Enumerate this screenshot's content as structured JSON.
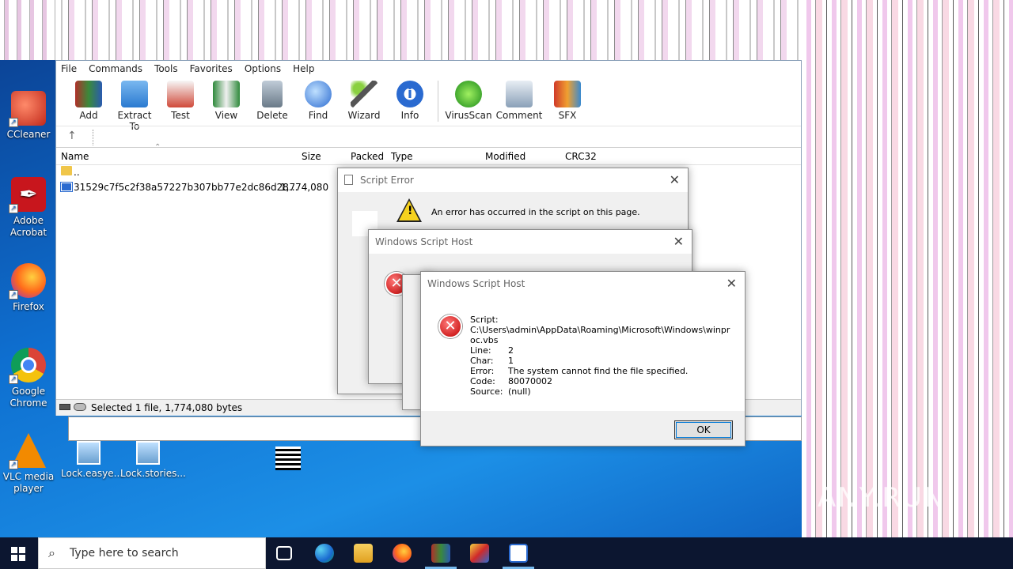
{
  "desktop": {
    "icons": [
      {
        "label": "CCleaner",
        "icon": "ccleaner-icon",
        "color": "#e8402d"
      },
      {
        "label": "Adobe Acrobat",
        "icon": "acrobat-icon",
        "color": "#d31f1f"
      },
      {
        "label": "Firefox",
        "icon": "firefox-icon",
        "color": "#ff7a1a"
      },
      {
        "label": "Google Chrome",
        "icon": "chrome-icon",
        "color": "#2e7de0"
      },
      {
        "label": "VLC media player",
        "icon": "vlc-icon",
        "color": "#f28a00"
      }
    ],
    "bottom_icons": [
      {
        "label": "Lock.easye...",
        "icon": "image-file-icon"
      },
      {
        "label": "Lock.stories...",
        "icon": "image-file-icon"
      }
    ],
    "watermark": "ANY.RUN"
  },
  "winrar": {
    "menu": [
      "File",
      "Commands",
      "Tools",
      "Favorites",
      "Options",
      "Help"
    ],
    "toolbar": [
      {
        "label": "Add",
        "icon": "add-archive-icon",
        "color": "#b0302a"
      },
      {
        "label": "Extract To",
        "icon": "extract-folder-icon",
        "color": "#3c8fe0"
      },
      {
        "label": "Test",
        "icon": "test-clipboard-icon",
        "color": "#c44a3a"
      },
      {
        "label": "View",
        "icon": "view-book-icon",
        "color": "#2f8a3c"
      },
      {
        "label": "Delete",
        "icon": "delete-bin-icon",
        "color": "#8a9aa8"
      },
      {
        "label": "Find",
        "icon": "find-magnifier-icon",
        "color": "#3a6fd0"
      },
      {
        "label": "Wizard",
        "icon": "wizard-wand-icon",
        "color": "#7a9a40"
      },
      {
        "label": "Info",
        "icon": "info-icon",
        "color": "#2a6fd0"
      },
      {
        "label": "VirusScan",
        "icon": "virusscan-icon",
        "color": "#2c9a2c"
      },
      {
        "label": "Comment",
        "icon": "comment-icon",
        "color": "#6a8aa8"
      },
      {
        "label": "SFX",
        "icon": "sfx-icon",
        "color": "#d0603a"
      }
    ],
    "columns": {
      "name": "Name",
      "size": "Size",
      "packed": "Packed",
      "type": "Type",
      "modified": "Modified",
      "crc": "CRC32"
    },
    "rows": [
      {
        "name": "..",
        "size": ""
      },
      {
        "name": "31529c7f5c2f38a57227b307bb77e2dc86d28...",
        "size": "1,774,080"
      }
    ],
    "status": "Selected 1 file, 1,774,080 bytes"
  },
  "script_error": {
    "title": "Script Error",
    "message": "An error has occurred in the script on this page."
  },
  "wsh_back": {
    "title": "Windows Script Host"
  },
  "wsh_front": {
    "title": "Windows Script Host",
    "script_label": "Script:",
    "script_path_1": "C:\\Users\\admin\\AppData\\Roaming\\Microsoft\\Windows\\winpr",
    "script_path_2": "oc.vbs",
    "line_label": "Line:",
    "line_value": "2",
    "char_label": "Char:",
    "char_value": "1",
    "error_label": "Error:",
    "error_value": "The system cannot find the file specified.",
    "code_label": "Code:",
    "code_value": "80070002",
    "source_label": "Source:",
    "source_value": "(null)",
    "ok_label": "OK"
  },
  "taskbar": {
    "search_placeholder": "Type here to search"
  }
}
